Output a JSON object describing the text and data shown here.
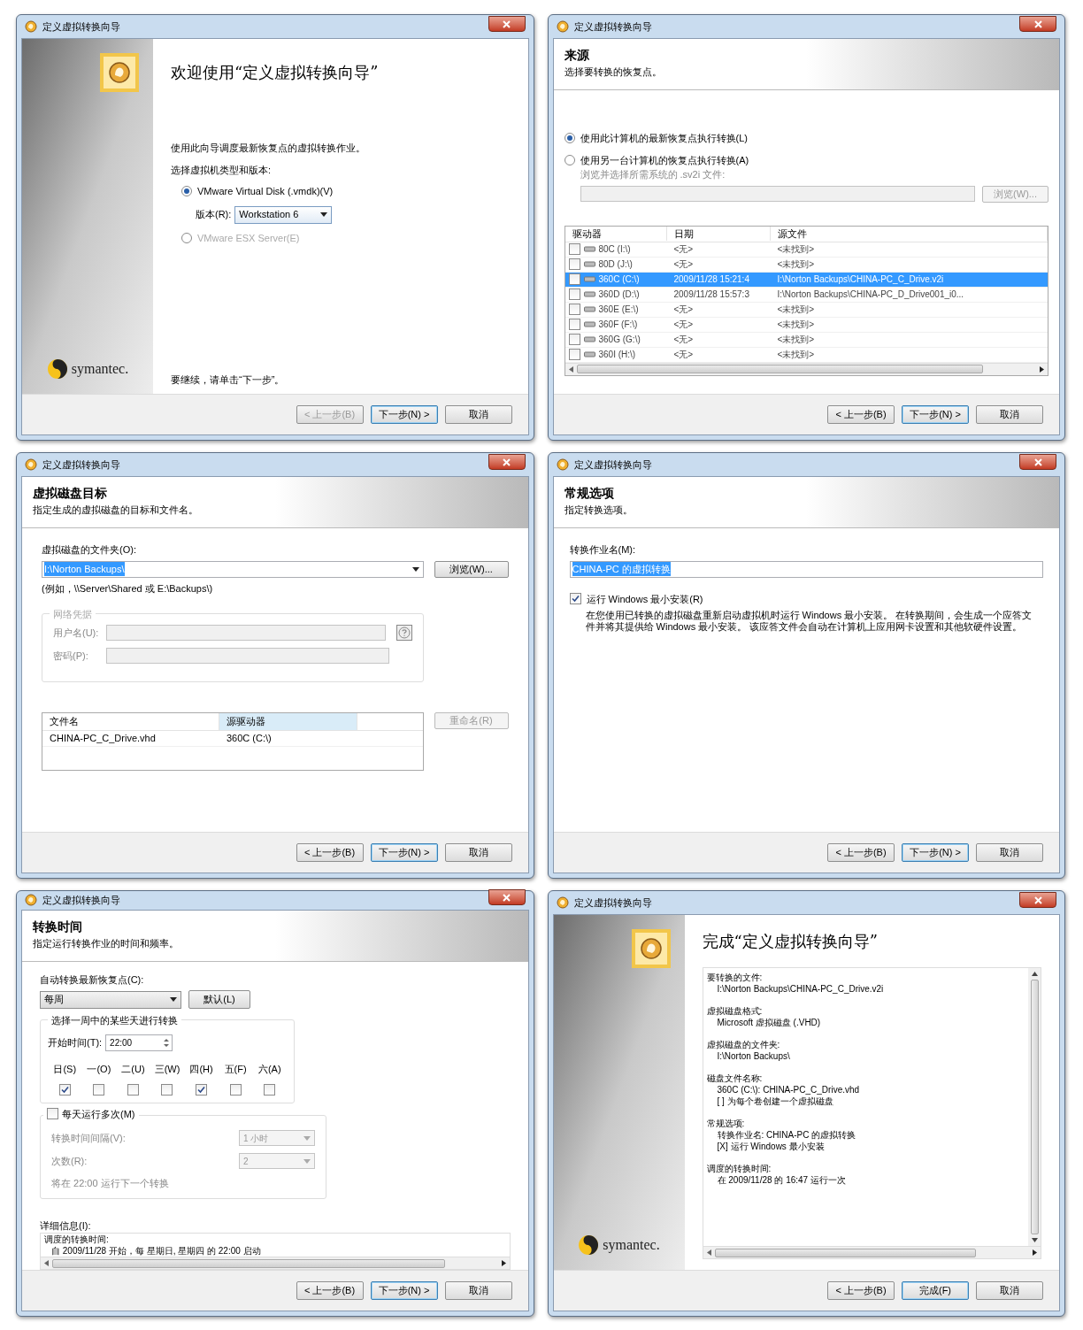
{
  "windows": [
    {
      "kind": "welcome",
      "title": "定义虚拟转换向导",
      "heading": "欢迎使用“定义虚拟转换向导”",
      "intro": "使用此向导调度最新恢复点的虚拟转换作业。",
      "prompt": "选择虚拟机类型和版本:",
      "radios": [
        {
          "label": "VMware Virtual Disk (.vmdk)(V)",
          "selected": true,
          "disabled": false
        },
        {
          "label": "VMware ESX Server(E)",
          "selected": false,
          "disabled": true
        }
      ],
      "version_label": "版本(R):",
      "version_value": "Workstation 6",
      "continue_hint": "要继续，请单击“下一步”。",
      "logo_text": "symantec.",
      "buttons": [
        {
          "label": "< 上一步(B)",
          "default": false,
          "disabled": true
        },
        {
          "label": "下一步(N) >",
          "default": true,
          "disabled": false
        },
        {
          "label": "取消",
          "default": false,
          "disabled": false
        }
      ]
    },
    {
      "kind": "source",
      "title": "定义虚拟转换向导",
      "heading": "来源",
      "subheading": "选择要转换的恢复点。",
      "radios": [
        {
          "label": "使用此计算机的最新恢复点执行转换(L)",
          "selected": true,
          "disabled": false
        },
        {
          "label": "使用另一台计算机的恢复点执行转换(A)",
          "selected": false,
          "disabled": false
        }
      ],
      "browse_hint": "浏览并选择所需系统的 .sv2i 文件:",
      "browse_button": "浏览(W)...",
      "table": {
        "columns": [
          "驱动器",
          "日期",
          "源文件"
        ],
        "rows": [
          {
            "cells": [
              "80C (I:\\)",
              "<无>",
              "<未找到>"
            ],
            "checked": false,
            "selected": false
          },
          {
            "cells": [
              "80D (J:\\)",
              "<无>",
              "<未找到>"
            ],
            "checked": false,
            "selected": false
          },
          {
            "cells": [
              "360C (C:\\)",
              "2009/11/28 15:21:4",
              "I:\\Norton Backups\\CHINA-PC_C_Drive.v2i"
            ],
            "checked": false,
            "selected": true
          },
          {
            "cells": [
              "360D (D:\\)",
              "2009/11/28 15:57:3",
              "I:\\Norton Backups\\CHINA-PC_D_Drive001_i0..."
            ],
            "checked": false,
            "selected": false
          },
          {
            "cells": [
              "360E (E:\\)",
              "<无>",
              "<未找到>"
            ],
            "checked": false,
            "selected": false
          },
          {
            "cells": [
              "360F (F:\\)",
              "<无>",
              "<未找到>"
            ],
            "checked": false,
            "selected": false
          },
          {
            "cells": [
              "360G (G:\\)",
              "<无>",
              "<未找到>"
            ],
            "checked": false,
            "selected": false
          },
          {
            "cells": [
              "360I (H:\\)",
              "<无>",
              "<未找到>"
            ],
            "checked": false,
            "selected": false
          }
        ]
      },
      "buttons": [
        {
          "label": "< 上一步(B)",
          "default": false,
          "disabled": false
        },
        {
          "label": "下一步(N) >",
          "default": true,
          "disabled": false
        },
        {
          "label": "取消",
          "default": false,
          "disabled": false
        }
      ]
    },
    {
      "kind": "disk",
      "title": "定义虚拟转换向导",
      "heading": "虚拟磁盘目标",
      "subheading": "指定生成的虚拟磁盘的目标和文件名。",
      "folder_label": "虚拟磁盘的文件夹(O):",
      "folder_value": "I:\\Norton Backups\\",
      "browse_button": "浏览(W)...",
      "example": "(例如，\\\\Server\\Shared 或 E:\\Backups\\)",
      "credentials": {
        "legend": "网络凭据",
        "username_label": "用户名(U):",
        "password_label": "密码(P):"
      },
      "table": {
        "columns": [
          "文件名",
          "源驱动器"
        ],
        "rows": [
          {
            "cells": [
              "CHINA-PC_C_Drive.vhd",
              "360C (C:\\)"
            ]
          }
        ]
      },
      "rename_button": "重命名(R)",
      "buttons": [
        {
          "label": "< 上一步(B)",
          "default": false,
          "disabled": false
        },
        {
          "label": "下一步(N) >",
          "default": true,
          "disabled": false
        },
        {
          "label": "取消",
          "default": false,
          "disabled": false
        }
      ]
    },
    {
      "kind": "options",
      "title": "定义虚拟转换向导",
      "heading": "常规选项",
      "subheading": "指定转换选项。",
      "job_label": "转换作业名(M):",
      "job_value": "CHINA-PC 的虚拟转换",
      "checkbox": {
        "label": "运行 Windows 最小安装(R)",
        "checked": true
      },
      "description": "在您使用已转换的虚拟磁盘重新启动虚拟机时运行 Windows 最小安装。 在转换期间，会生成一个应答文件并将其提供给 Windows 最小安装。 该应答文件会自动在计算机上应用网卡设置和其他软硬件设置。",
      "buttons": [
        {
          "label": "< 上一步(B)",
          "default": false,
          "disabled": false
        },
        {
          "label": "下一步(N) >",
          "default": true,
          "disabled": false
        },
        {
          "label": "取消",
          "default": false,
          "disabled": false
        }
      ]
    },
    {
      "kind": "schedule",
      "title": "定义虚拟转换向导",
      "heading": "转换时间",
      "subheading": "指定运行转换作业的时间和频率。",
      "auto_label": "自动转换最新恢复点(C):",
      "frequency": "每周",
      "default_button": "默认(L)",
      "days_group": {
        "legend": "选择一周中的某些天进行转换",
        "start_label": "开始时间(T):",
        "start_value": "22:00",
        "days": [
          {
            "label": "日(S)",
            "checked": true
          },
          {
            "label": "一(O)",
            "checked": false
          },
          {
            "label": "二(U)",
            "checked": false
          },
          {
            "label": "三(W)",
            "checked": false
          },
          {
            "label": "四(H)",
            "checked": true
          },
          {
            "label": "五(F)",
            "checked": false
          },
          {
            "label": "六(A)",
            "checked": false
          }
        ]
      },
      "multi": {
        "label": "每天运行多次(M)",
        "checked": false,
        "interval_label": "转换时间间隔(V):",
        "interval_value": "1 小时",
        "count_label": "次数(R):",
        "count_value": "2",
        "note": "将在 22:00 运行下一个转换"
      },
      "details_label": "详细信息(I):",
      "details": [
        "调度的转换时间:",
        "自 2009/11/28 开始，每 星期日, 星期四 的 22:00 启动"
      ],
      "buttons": [
        {
          "label": "< 上一步(B)",
          "default": false,
          "disabled": false
        },
        {
          "label": "下一步(N) >",
          "default": true,
          "disabled": false
        },
        {
          "label": "取消",
          "default": false,
          "disabled": false
        }
      ]
    },
    {
      "kind": "finish",
      "title": "定义虚拟转换向导",
      "heading": "完成“定义虚拟转换向导”",
      "logo_text": "symantec.",
      "summary": [
        {
          "label": "要转换的文件:",
          "lines": [
            "I:\\Norton Backups\\CHINA-PC_C_Drive.v2i"
          ]
        },
        {
          "label": "虚拟磁盘格式:",
          "lines": [
            "Microsoft 虚拟磁盘 (.VHD)"
          ]
        },
        {
          "label": "虚拟磁盘的文件夹:",
          "lines": [
            "I:\\Norton Backups\\"
          ]
        },
        {
          "label": "磁盘文件名称:",
          "lines": [
            "360C (C:\\): CHINA-PC_C_Drive.vhd",
            "[ ] 为每个卷创建一个虚拟磁盘"
          ]
        },
        {
          "label": "常规选项:",
          "lines": [
            "转换作业名: CHINA-PC 的虚拟转换",
            "[X] 运行 Windows 最小安装"
          ]
        },
        {
          "label": "调度的转换时间:",
          "lines": [
            "在 2009/11/28 的 16:47 运行一次"
          ]
        }
      ],
      "buttons": [
        {
          "label": "< 上一步(B)",
          "default": false,
          "disabled": false
        },
        {
          "label": "完成(F)",
          "default": true,
          "disabled": false
        },
        {
          "label": "取消",
          "default": false,
          "disabled": false
        }
      ]
    }
  ]
}
